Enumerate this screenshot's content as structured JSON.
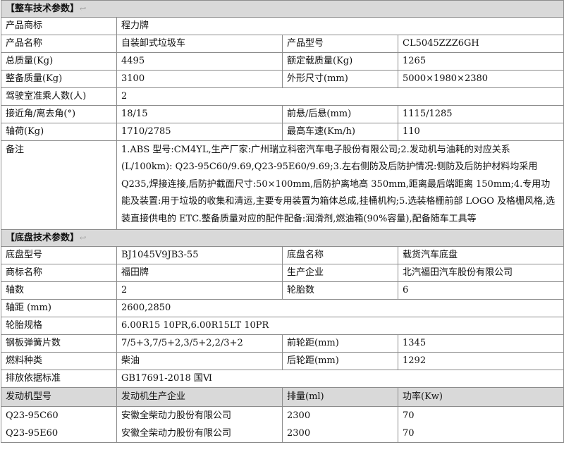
{
  "vehicle_section": {
    "title": "【整车技术参数】"
  },
  "vehicle": {
    "brand_label": "产品商标",
    "brand_value": "程力牌",
    "name_label": "产品名称",
    "name_value": "自装卸式垃圾车",
    "model_label": "产品型号",
    "model_value": "CL5045ZZZ6GH",
    "total_mass_label": "总质量(Kg)",
    "total_mass_value": "4495",
    "rated_load_label": "额定载质量(Kg)",
    "rated_load_value": "1265",
    "curb_mass_label": "整备质量(Kg)",
    "curb_mass_value": "3100",
    "dimensions_label": "外形尺寸(mm)",
    "dimensions_value": "5000×1980×2380",
    "cab_seats_label": "驾驶室准乘人数(人)",
    "cab_seats_value": "2",
    "angles_label": "接近角/离去角(°)",
    "angles_value": "18/15",
    "overhang_label": "前悬/后悬(mm)",
    "overhang_value": "1115/1285",
    "axle_load_label": "轴荷(Kg)",
    "axle_load_value": "1710/2785",
    "max_speed_label": "最高车速(Km/h)",
    "max_speed_value": "110",
    "remarks_label": "备注",
    "remarks_value": "1.ABS 型号:CM4YL,生产厂家:广州瑞立科密汽车电子股份有限公司;2.发动机与油耗的对应关系(L/100km): Q23-95C60/9.69,Q23-95E60/9.69;3.左右侧防及后防护情况:侧防及后防护材料均采用 Q235,焊接连接,后防护截面尺寸:50×100mm,后防护离地高 350mm,距离最后端距离 150mm;4.专用功能及装置:用于垃圾的收集和清运,主要专用装置为箱体总成,挂桶机构;5.选装格栅前部 LOGO 及格栅风格,选装直接供电的 ETC.整备质量对应的配件配备:润滑剂,燃油箱(90%容量),配备随车工具等"
  },
  "chassis_section": {
    "title": "【底盘技术参数】"
  },
  "chassis": {
    "model_label": "底盘型号",
    "model_value": "BJ1045V9JB3-55",
    "name_label": "底盘名称",
    "name_value": "载货汽车底盘",
    "brand_label": "商标名称",
    "brand_value": "福田牌",
    "maker_label": "生产企业",
    "maker_value": "北汽福田汽车股份有限公司",
    "axles_label": "轴数",
    "axles_value": "2",
    "tires_count_label": "轮胎数",
    "tires_count_value": "6",
    "wheelbase_label": "轴距 (mm)",
    "wheelbase_value": "2600,2850",
    "tire_spec_label": "轮胎规格",
    "tire_spec_value": "6.00R15 10PR,6.00R15LT 10PR",
    "springs_label": "钢板弹簧片数",
    "springs_value": "7/5+3,7/5+2,3/5+2,2/3+2",
    "front_track_label": "前轮距(mm)",
    "front_track_value": "1345",
    "fuel_label": "燃料种类",
    "fuel_value": "柴油",
    "rear_track_label": "后轮距(mm)",
    "rear_track_value": "1292",
    "emission_label": "排放依据标准",
    "emission_value": "GB17691-2018 国Ⅵ"
  },
  "engine_table": {
    "headers": [
      "发动机型号",
      "发动机生产企业",
      "排量(ml)",
      "功率(Kw)"
    ],
    "rows": [
      [
        "Q23-95C60",
        "安徽全柴动力股份有限公司",
        "2300",
        "70"
      ],
      [
        "Q23-95E60",
        "安徽全柴动力股份有限公司",
        "2300",
        "70"
      ]
    ]
  }
}
